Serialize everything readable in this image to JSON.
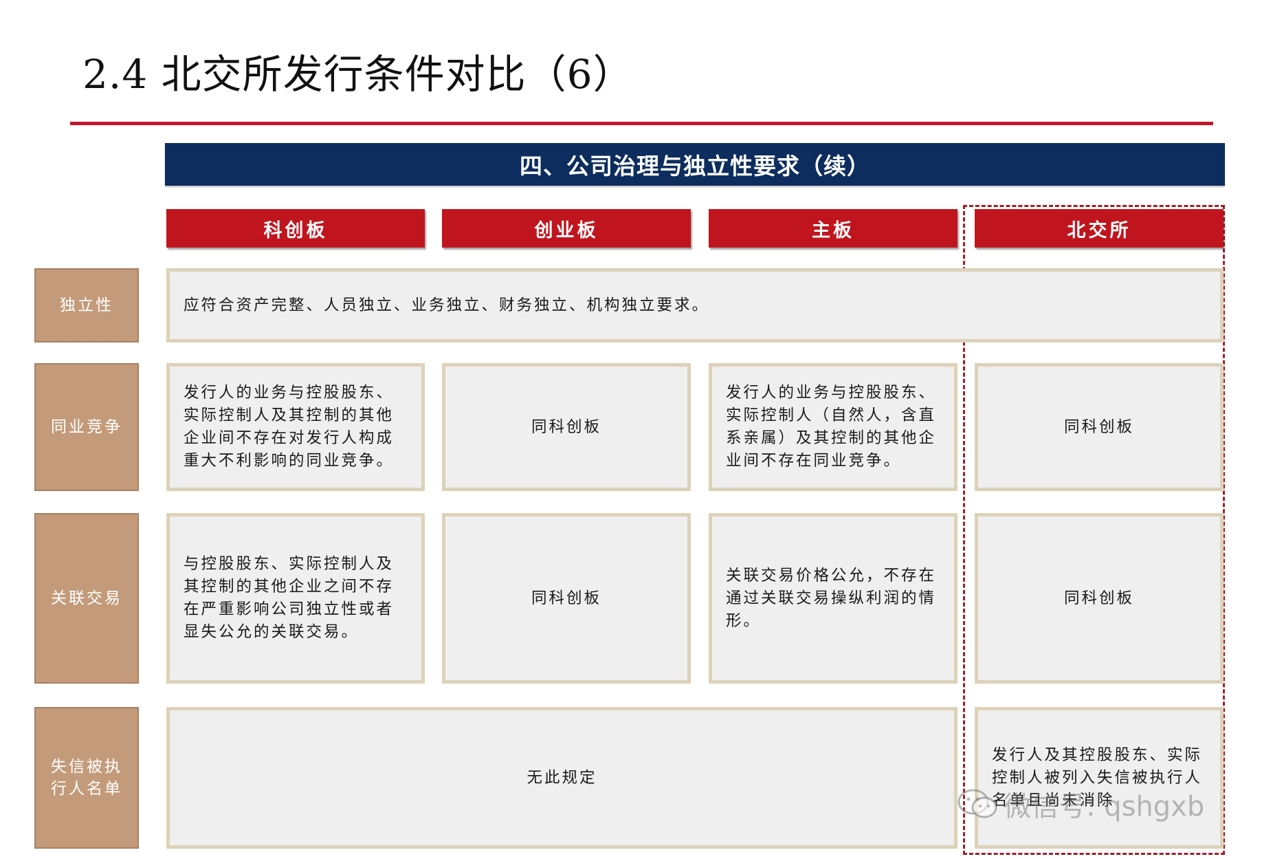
{
  "title": "2.4 北交所发行条件对比（6）",
  "banner": "四、公司治理与独立性要求（续）",
  "columns": [
    "科创板",
    "创业板",
    "主板",
    "北交所"
  ],
  "rows": {
    "independence": {
      "label": "独立性",
      "text": "应符合资产完整、人员独立、业务独立、财务独立、机构独立要求。"
    },
    "competition": {
      "label": "同业竞争",
      "kcb": "发行人的业务与控股股东、实际控制人及其控制的其他企业间不存在对发行人构成重大不利影响的同业竞争。",
      "cyb": "同科创板",
      "zb": "发行人的业务与控股股东、实际控制人（自然人，含直系亲属）及其控制的其他企业间不存在同业竞争。",
      "bjs": "同科创板"
    },
    "related": {
      "label": "关联交易",
      "kcb": "与控股股东、实际控制人及其控制的其他企业之间不存在严重影响公司独立性或者显失公允的关联交易。",
      "cyb": "同科创板",
      "zb": "关联交易价格公允，不存在通过关联交易操纵利润的情形。",
      "bjs": "同科创板"
    },
    "dishonest": {
      "label": "失信被执行人名单",
      "others": "无此规定",
      "bjs": "发行人及其控股股东、实际控制人被列入失信被执行人名单且尚未消除"
    }
  },
  "watermark": "微信号: qshgxb"
}
